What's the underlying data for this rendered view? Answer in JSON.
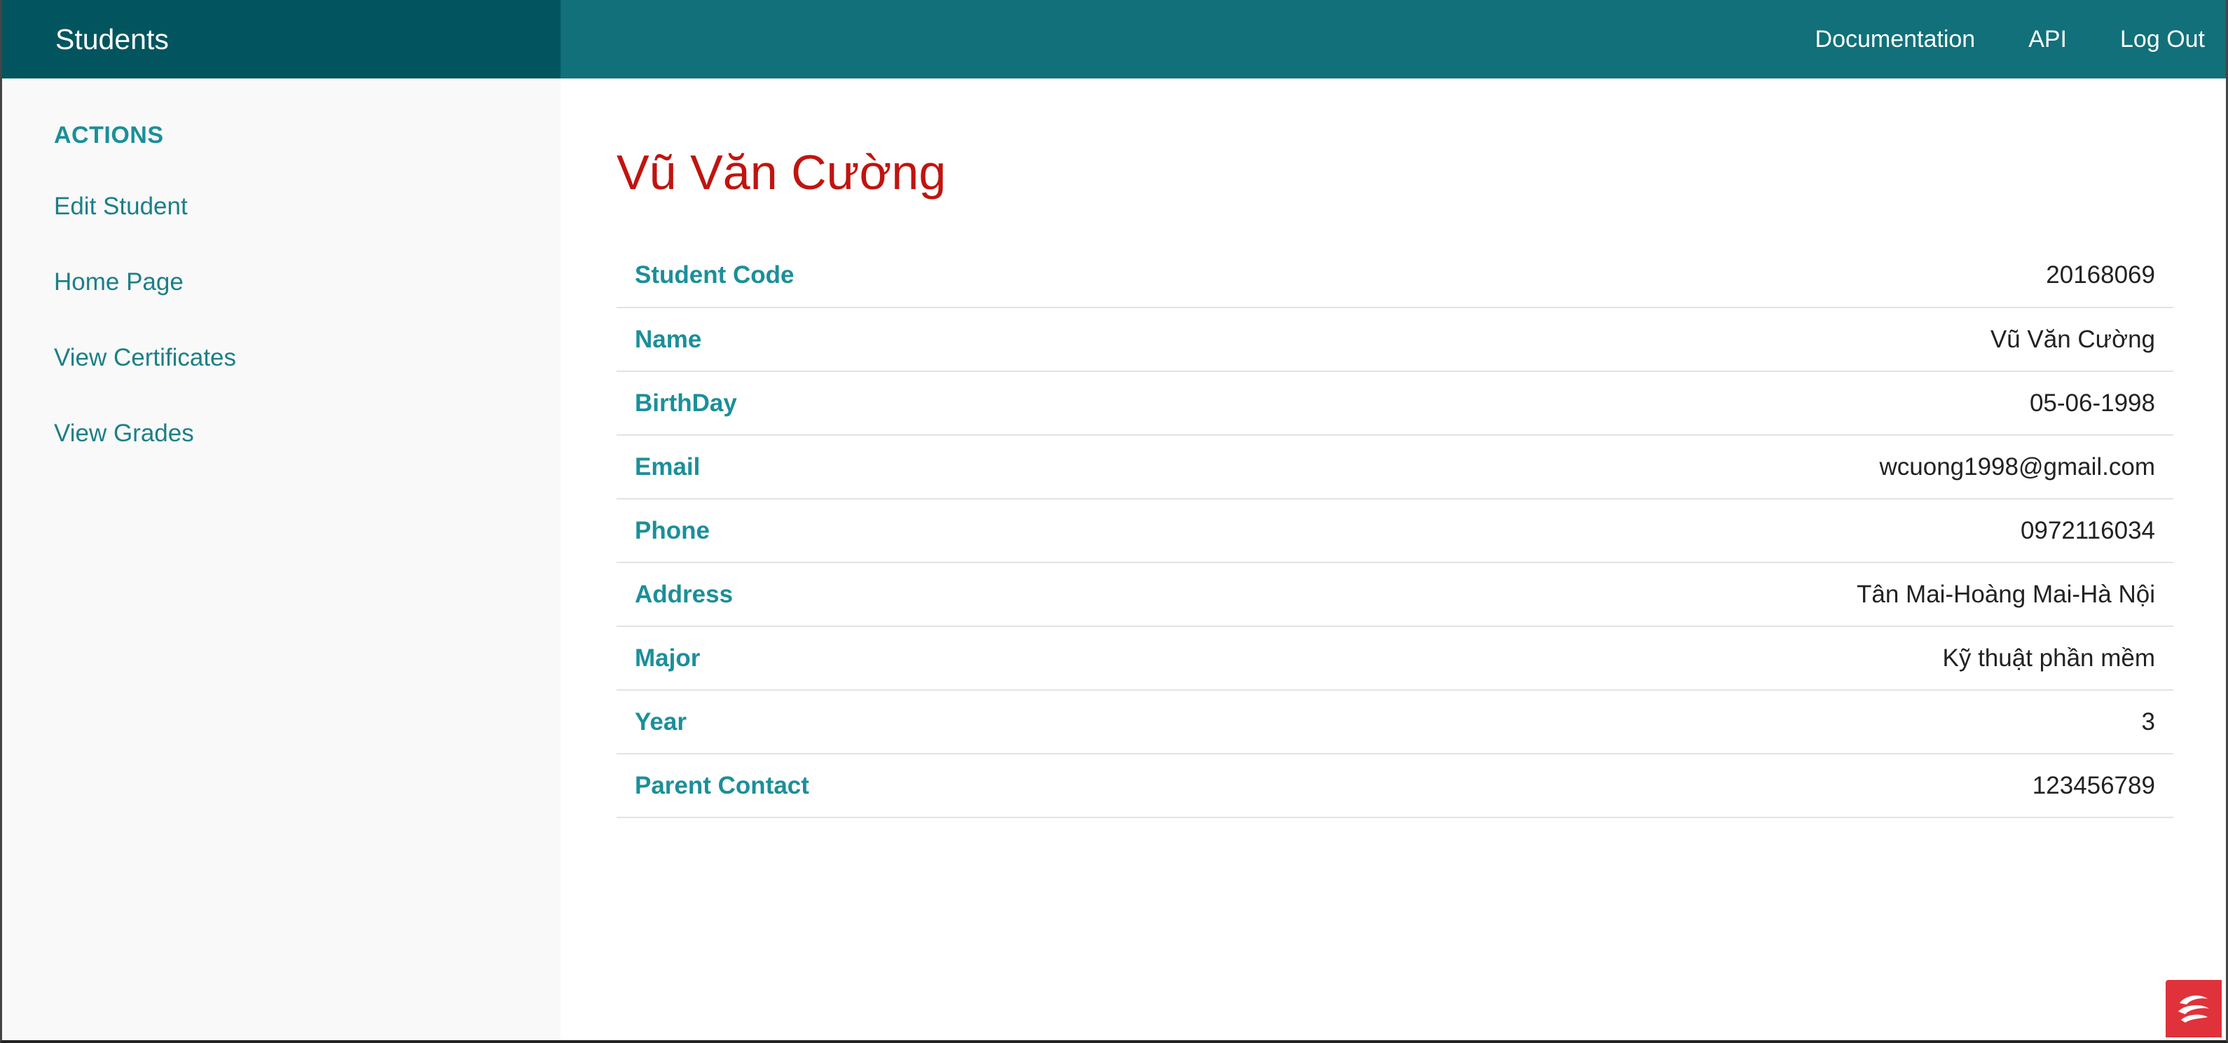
{
  "brand": "Students",
  "nav": {
    "documentation": "Documentation",
    "api": "API",
    "logout": "Log Out"
  },
  "sidebar": {
    "heading": "ACTIONS",
    "items": [
      {
        "label": "Edit Student"
      },
      {
        "label": "Home Page"
      },
      {
        "label": "View Certificates"
      },
      {
        "label": "View Grades"
      }
    ]
  },
  "student": {
    "title": "Vũ Văn Cường",
    "rows": [
      {
        "label": "Student Code",
        "value": "20168069"
      },
      {
        "label": "Name",
        "value": "Vũ Văn Cường"
      },
      {
        "label": "BirthDay",
        "value": "05-06-1998"
      },
      {
        "label": "Email",
        "value": "wcuong1998@gmail.com"
      },
      {
        "label": "Phone",
        "value": "0972116034"
      },
      {
        "label": "Address",
        "value": "Tân Mai-Hoàng Mai-Hà Nội"
      },
      {
        "label": "Major",
        "value": "Kỹ thuật phần mềm"
      },
      {
        "label": "Year",
        "value": "3"
      },
      {
        "label": "Parent Contact",
        "value": "123456789"
      }
    ]
  },
  "colors": {
    "brand_bg": "#02555e",
    "topbar_bg": "#117079",
    "accent": "#1b8f99",
    "title": "#c0140f"
  },
  "icons": {
    "corner_badge": "app-logo-icon"
  }
}
